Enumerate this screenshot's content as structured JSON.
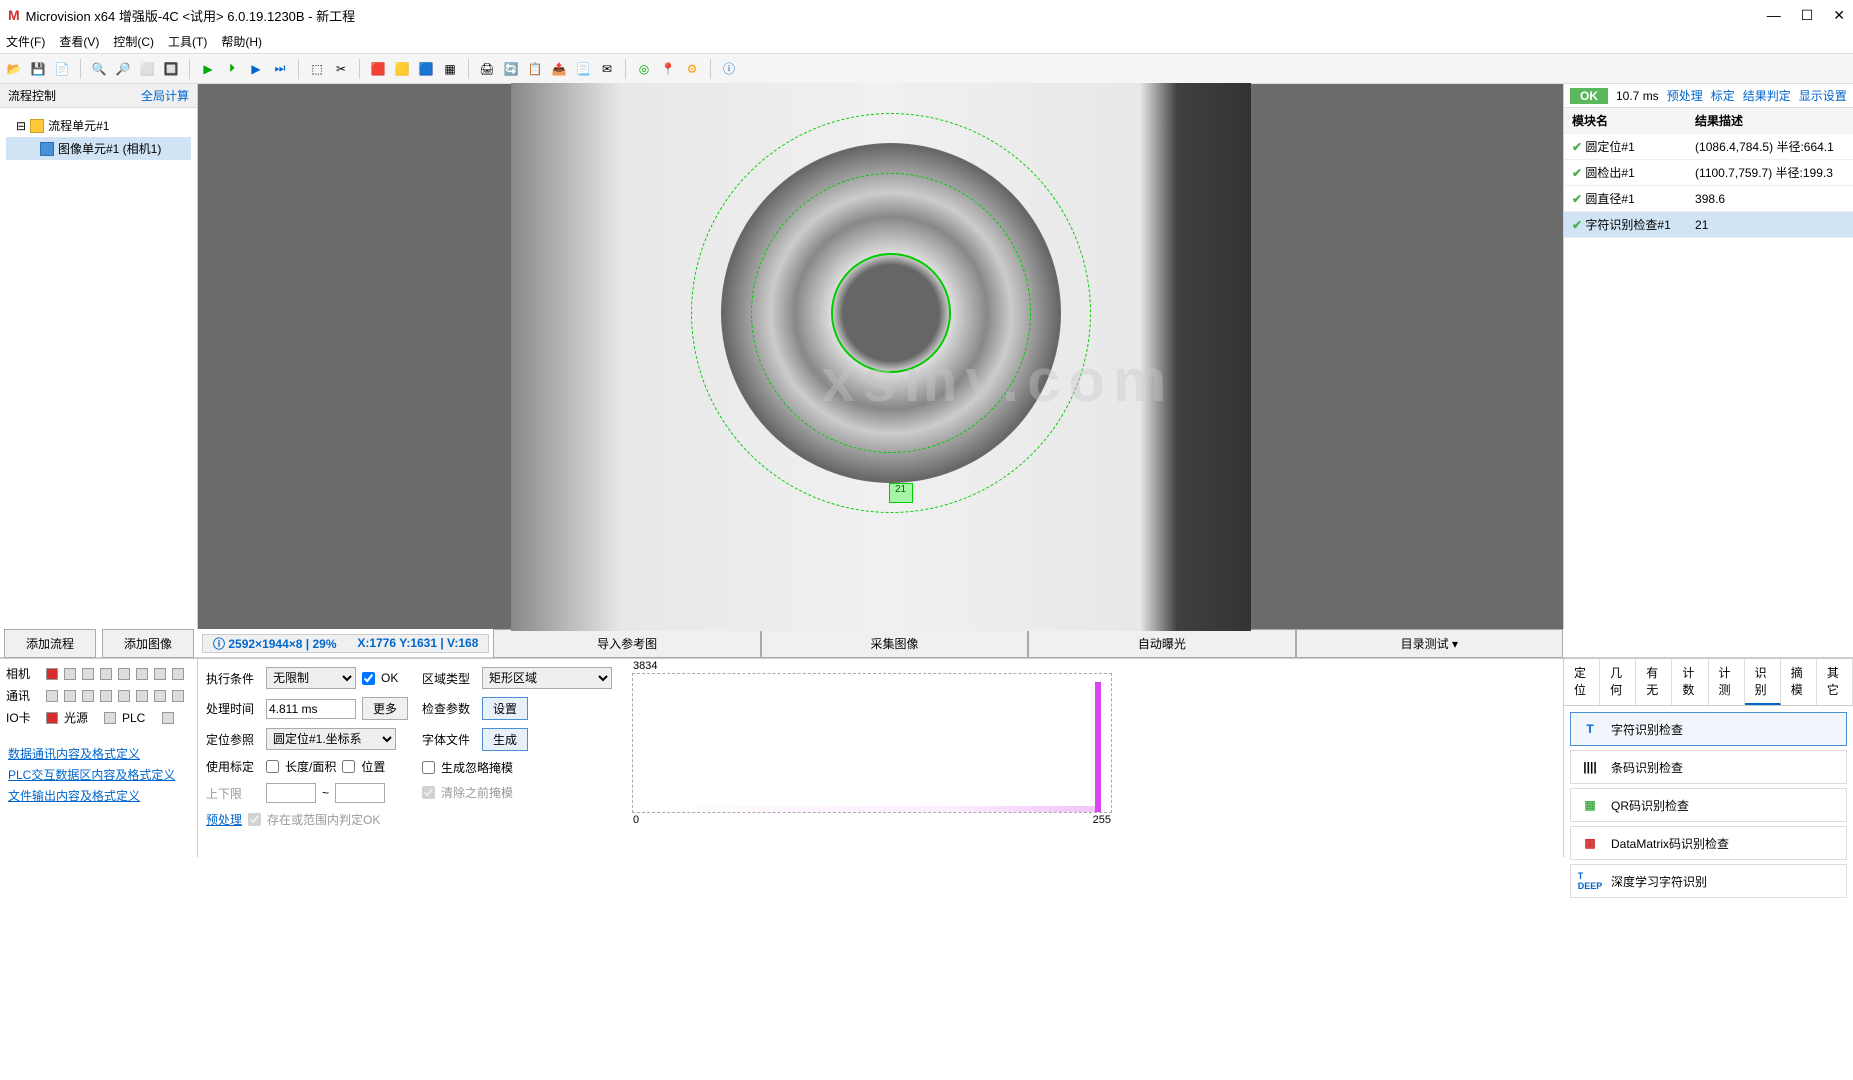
{
  "titlebar": {
    "app": "Microvision x64 增强版-4C <试用> 6.0.19.1230B - 新工程"
  },
  "menu": [
    "文件(F)",
    "查看(V)",
    "控制(C)",
    "工具(T)",
    "帮助(H)"
  ],
  "left": {
    "title": "流程控制",
    "link": "全局计算",
    "tree_root": "流程单元#1",
    "tree_child": "图像单元#1 (相机1)",
    "add_flow": "添加流程",
    "add_image": "添加图像"
  },
  "status_labels": {
    "camera": "相机",
    "comm": "通讯",
    "io": "IO卡",
    "light": "光源",
    "plc": "PLC"
  },
  "links": [
    "数据通讯内容及格式定义",
    "PLC交互数据区内容及格式定义",
    "文件输出内容及格式定义"
  ],
  "info": {
    "dim": "2592×1944×8 | 29%",
    "pos": "X:1776  Y:1631 | V:168"
  },
  "action_btns": [
    "导入参考图",
    "采集图像",
    "自动曝光",
    "目录测试"
  ],
  "params": {
    "exec_cond": "执行条件",
    "exec_val": "无限制",
    "ok": "OK",
    "proc_time": "处理时间",
    "proc_val": "4.811 ms",
    "more": "更多",
    "loc_ref": "定位参照",
    "loc_val": "圆定位#1.坐标系",
    "use_cal": "使用标定",
    "len_area": "长度/面积",
    "pos": "位置",
    "limit": "上下限",
    "preproc": "预处理",
    "save_in_range": "存在或范围内判定OK",
    "region_type": "区域类型",
    "region_val": "矩形区域",
    "check_param": "检查参数",
    "set": "设置",
    "font_file": "字体文件",
    "gen": "生成",
    "gen_ignore": "生成忽略掩模",
    "clear_prev": "清除之前掩模"
  },
  "histo": {
    "max": "3834",
    "min": "0",
    "right": "255"
  },
  "right": {
    "ok": "OK",
    "time": "10.7 ms",
    "links": [
      "预处理",
      "标定",
      "结果判定",
      "显示设置"
    ],
    "th_module": "模块名",
    "th_result": "结果描述",
    "rows": [
      {
        "name": "圆定位#1",
        "desc": "(1086.4,784.5) 半径:664.1"
      },
      {
        "name": "圆检出#1",
        "desc": "(1100.7,759.7) 半径:199.3"
      },
      {
        "name": "圆直径#1",
        "desc": "398.6"
      },
      {
        "name": "字符识别检查#1",
        "desc": "21"
      }
    ]
  },
  "tabs": [
    "定位",
    "几何",
    "有无",
    "计数",
    "计测",
    "识别",
    "摘模",
    "其它"
  ],
  "recog": [
    {
      "label": "字符识别检查",
      "icon": "T",
      "color": "#0066cc"
    },
    {
      "label": "条码识别检查",
      "icon": "||||",
      "color": "#333"
    },
    {
      "label": "QR码识别检查",
      "icon": "▦",
      "color": "#4caf50"
    },
    {
      "label": "DataMatrix码识别检查",
      "icon": "▩",
      "color": "#d32f2f"
    },
    {
      "label": "深度学习字符识别",
      "icon": "T",
      "color": "#0066cc"
    }
  ],
  "marker_text": "21"
}
